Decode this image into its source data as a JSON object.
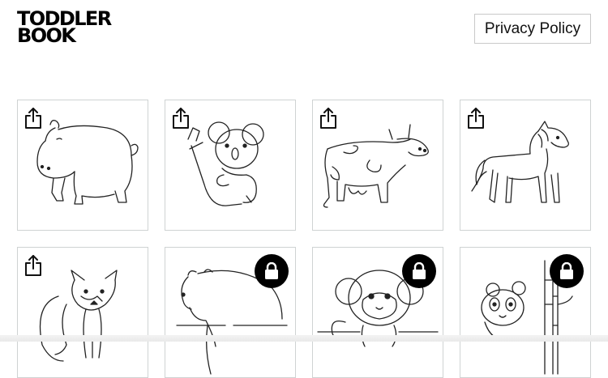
{
  "brand": {
    "line1": "TODDLER",
    "line2": "BOOK"
  },
  "header": {
    "privacy_label": "Privacy Policy"
  },
  "cards": [
    {
      "animal": "hippo",
      "locked": false,
      "icon": "share-icon"
    },
    {
      "animal": "koala",
      "locked": false,
      "icon": "share-icon"
    },
    {
      "animal": "cow",
      "locked": false,
      "icon": "share-icon"
    },
    {
      "animal": "horse",
      "locked": false,
      "icon": "share-icon"
    },
    {
      "animal": "fox",
      "locked": false,
      "icon": "share-icon"
    },
    {
      "animal": "bear",
      "locked": true,
      "icon": "lock-icon"
    },
    {
      "animal": "monkey",
      "locked": true,
      "icon": "lock-icon"
    },
    {
      "animal": "panda",
      "locked": true,
      "icon": "lock-icon"
    }
  ]
}
